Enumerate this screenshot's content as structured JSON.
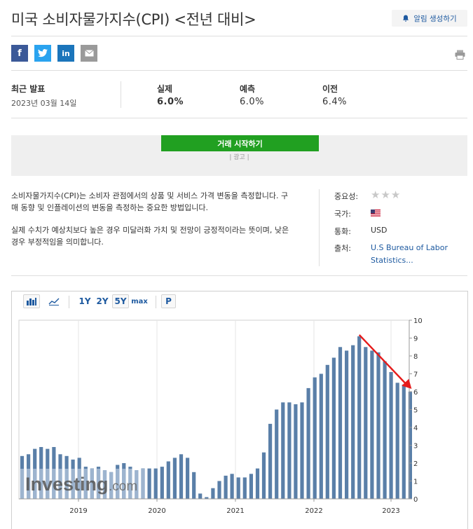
{
  "title": "미국 소비자물가지수(CPI) <전년 대비>",
  "alert_button": "알림 생성하기",
  "share_icons": [
    "facebook-icon",
    "twitter-icon",
    "linkedin-icon",
    "email-icon"
  ],
  "summary": {
    "latest_label": "최근 발표",
    "latest_date": "2023년 03월 14일",
    "actual_label": "실제",
    "actual_value": "6.0%",
    "forecast_label": "예측",
    "forecast_value": "6.0%",
    "previous_label": "이전",
    "previous_value": "6.4%"
  },
  "ad": {
    "button": "거래 시작하기",
    "label": "| 광고 |"
  },
  "description": {
    "p1": "소비자물가지수(CPI)는 소비자 관점에서의 상품 및 서비스 가격 변동을 측정합니다. 구매 동향 및 인플레이션의 변동을 측정하는 중요한 방법입니다.",
    "p2": "실제 수치가 예상치보다 높은 경우 미달러화 가치 및 전망이 긍정적이라는 뜻이며, 낮은 경우 부정적임을 의미합니다."
  },
  "meta": {
    "importance_label": "중요성:",
    "importance_stars": 3,
    "country_label": "국가:",
    "currency_label": "통화:",
    "currency_value": "USD",
    "source_label": "출처:",
    "source_line1": "U.S Bureau of Labor",
    "source_line2": "Statistics..."
  },
  "toolbar": {
    "range_1y": "1Y",
    "range_2y": "2Y",
    "range_5y": "5Y",
    "range_max": "max",
    "p_button": "P"
  },
  "watermark": {
    "brand": "Investing",
    "suffix": ".com"
  },
  "colors": {
    "bar": "#5a7fa8",
    "bar_faded": "#9db4cf",
    "arrow": "#e51b1b",
    "link": "#1e5aa0",
    "button_green": "#21a021"
  },
  "chart_data": {
    "type": "bar",
    "series": [
      {
        "values": [
          2.4,
          2.5,
          2.8,
          2.9,
          2.8,
          2.9,
          2.5,
          2.4,
          2.2,
          2.3,
          1.8,
          1.7,
          1.8,
          1.6,
          1.5,
          1.9,
          2.0,
          1.8,
          1.6,
          1.7,
          1.7,
          1.7,
          1.8,
          2.1,
          2.3,
          2.5,
          2.3,
          1.5,
          0.3,
          0.1,
          0.6,
          1.0,
          1.3,
          1.4,
          1.2,
          1.2,
          1.4,
          1.7,
          2.6,
          4.2,
          5.0,
          5.4,
          5.4,
          5.3,
          5.4,
          6.2,
          6.8,
          7.0,
          7.5,
          7.9,
          8.5,
          8.3,
          8.6,
          9.1,
          8.5,
          8.3,
          8.2,
          7.7,
          7.1,
          6.5,
          6.4,
          6.0
        ]
      }
    ],
    "x_tick_labels": [
      "2019",
      "2020",
      "2021",
      "2022",
      "2023"
    ],
    "y_ticks": [
      0,
      1,
      2,
      3,
      4,
      5,
      6,
      7,
      8,
      9,
      10
    ],
    "ylim": [
      0,
      10
    ],
    "annotation": "red arrow from 2022 peak down to latest value"
  }
}
